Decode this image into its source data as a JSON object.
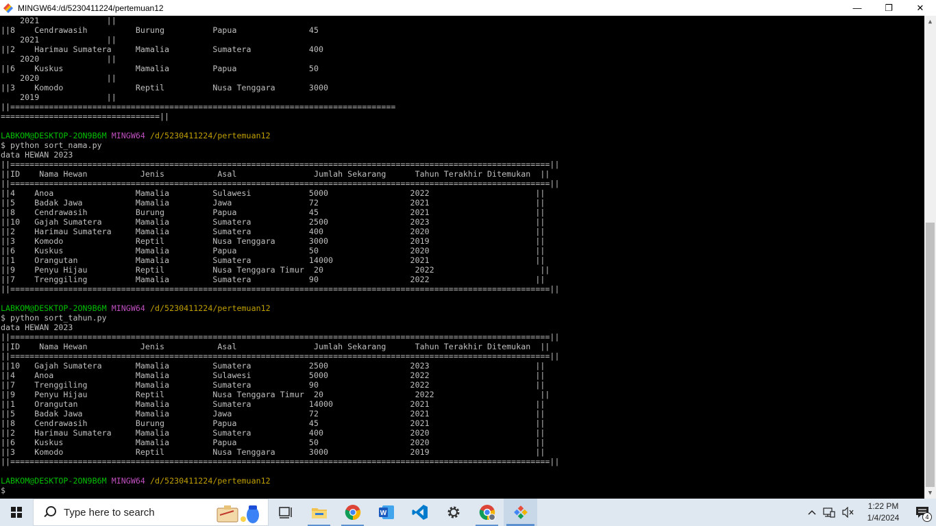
{
  "window": {
    "title": "MINGW64:/d/5230411224/pertemuan12",
    "minimize": "—",
    "maximize": "❐",
    "close": "✕"
  },
  "terminal": {
    "lines": [
      {
        "t": "    2021              ||"
      },
      {
        "t": "||8    Cendrawasih          Burung          Papua               45"
      },
      {
        "t": "    2021              ||"
      },
      {
        "t": "||2    Harimau Sumatera     Mamalia         Sumatera            400"
      },
      {
        "t": "    2020              ||"
      },
      {
        "t": "||6    Kuskus               Mamalia         Papua               50"
      },
      {
        "t": "    2020              ||"
      },
      {
        "t": "||3    Komodo               Reptil          Nusa Tenggara       3000"
      },
      {
        "t": "    2019              ||"
      },
      {
        "t": "||================================================================================"
      },
      {
        "t": "=================================||"
      },
      {
        "t": ""
      },
      {
        "prompt": true,
        "user": "LABKOM@DESKTOP-2ON9B6M",
        "sys": "MINGW64",
        "path": "/d/5230411224/pertemuan12"
      },
      {
        "t": "$ python sort_nama.py"
      },
      {
        "t": "data HEWAN 2023"
      },
      {
        "t": "||================================================================================================================||"
      },
      {
        "t": "||ID    Nama Hewan           Jenis           Asal                Jumlah Sekarang      Tahun Terakhir Ditemukan  ||"
      },
      {
        "t": "||================================================================================================================||"
      },
      {
        "t": "||4    Anoa                 Mamalia         Sulawesi            5000                 2022                      ||"
      },
      {
        "t": "||5    Badak Jawa           Mamalia         Jawa                72                   2021                      ||"
      },
      {
        "t": "||8    Cendrawasih          Burung          Papua               45                   2021                      ||"
      },
      {
        "t": "||10   Gajah Sumatera       Mamalia         Sumatera            2500                 2023                      ||"
      },
      {
        "t": "||2    Harimau Sumatera     Mamalia         Sumatera            400                  2020                      ||"
      },
      {
        "t": "||3    Komodo               Reptil          Nusa Tenggara       3000                 2019                      ||"
      },
      {
        "t": "||6    Kuskus               Mamalia         Papua               50                   2020                      ||"
      },
      {
        "t": "||1    Orangutan            Mamalia         Sumatera            14000                2021                      ||"
      },
      {
        "t": "||9    Penyu Hijau          Reptil          Nusa Tenggara Timur  20                   2022                      ||"
      },
      {
        "t": "||7    Trenggiling          Mamalia         Sumatera            90                   2022                      ||"
      },
      {
        "t": "||================================================================================================================||"
      },
      {
        "t": ""
      },
      {
        "prompt": true,
        "user": "LABKOM@DESKTOP-2ON9B6M",
        "sys": "MINGW64",
        "path": "/d/5230411224/pertemuan12"
      },
      {
        "t": "$ python sort_tahun.py"
      },
      {
        "t": "data HEWAN 2023"
      },
      {
        "t": "||================================================================================================================||"
      },
      {
        "t": "||ID    Nama Hewan           Jenis           Asal                Jumlah Sekarang      Tahun Terakhir Ditemukan  ||"
      },
      {
        "t": "||================================================================================================================||"
      },
      {
        "t": "||10   Gajah Sumatera       Mamalia         Sumatera            2500                 2023                      ||"
      },
      {
        "t": "||4    Anoa                 Mamalia         Sulawesi            5000                 2022                      ||"
      },
      {
        "t": "||7    Trenggiling          Mamalia         Sumatera            90                   2022                      ||"
      },
      {
        "t": "||9    Penyu Hijau          Reptil          Nusa Tenggara Timur  20                   2022                      ||"
      },
      {
        "t": "||1    Orangutan            Mamalia         Sumatera            14000                2021                      ||"
      },
      {
        "t": "||5    Badak Jawa           Mamalia         Jawa                72                   2021                      ||"
      },
      {
        "t": "||8    Cendrawasih          Burung          Papua               45                   2021                      ||"
      },
      {
        "t": "||2    Harimau Sumatera     Mamalia         Sumatera            400                  2020                      ||"
      },
      {
        "t": "||6    Kuskus               Mamalia         Papua               50                   2020                      ||"
      },
      {
        "t": "||3    Komodo               Reptil          Nusa Tenggara       3000                 2019                      ||"
      },
      {
        "t": "||================================================================================================================||"
      },
      {
        "t": ""
      },
      {
        "prompt": true,
        "user": "LABKOM@DESKTOP-2ON9B6M",
        "sys": "MINGW64",
        "path": "/d/5230411224/pertemuan12"
      },
      {
        "t": "$"
      }
    ]
  },
  "colors": {
    "prompt_user": "#00c000",
    "prompt_sys": "#c050c0",
    "prompt_path": "#c0a000",
    "text": "#c0c0c0"
  },
  "taskbar": {
    "search_placeholder": "Type here to search",
    "apps": [
      "task-view-icon",
      "file-explorer-icon",
      "chrome-icon",
      "word-icon",
      "vscode-icon",
      "settings-icon",
      "chrome-profile-icon",
      "git-bash-icon"
    ],
    "time": "1:22 PM",
    "date": "1/4/2024",
    "notification_count": "4"
  }
}
